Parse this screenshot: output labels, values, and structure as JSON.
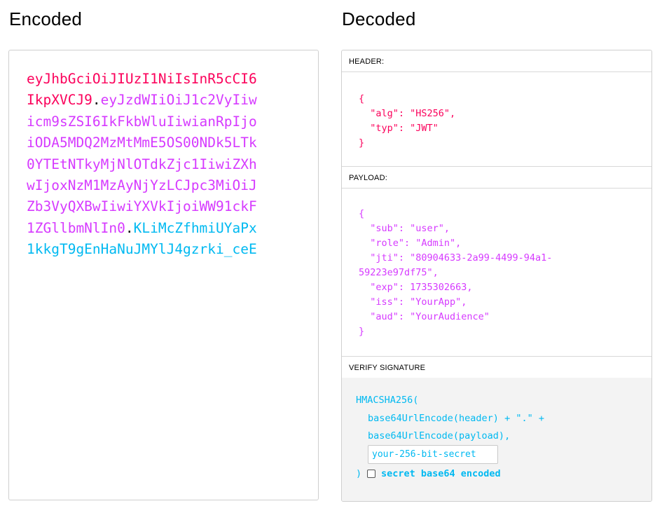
{
  "encoded": {
    "title": "Encoded",
    "header_lines": [
      "eyJhbGciOiJIUzI1NiIsInR5cCI6",
      "IkpXVCJ9"
    ],
    "dot1": ".",
    "payload_first": "eyJzdWIiOiJ1c2VyIiw",
    "payload_lines": [
      "icm9sZSI6IkFkbWluIiwianRpIjo",
      "iODA5MDQ2MzMtMmE5OS00NDk5LTk",
      "0YTEtNTkyMjNlOTdkZjc1IiwiZXh",
      "wIjoxNzM1MzAyNjYzLCJpc3MiOiJ",
      "Zb3VyQXBwIiwiYXVkIjoiWW91ckF"
    ],
    "payload_last": "1ZGllbmNlIn0",
    "dot2": ".",
    "signature_first": "KLiMcZfhmiUYaPx",
    "signature_last": "1kkgT9gEnHaNuJMYlJ4gzrki_ceE"
  },
  "decoded": {
    "title": "Decoded",
    "header_label": "HEADER:",
    "header_json": "{\n  \"alg\": \"HS256\",\n  \"typ\": \"JWT\"\n}",
    "payload_label": "PAYLOAD:",
    "payload_json": "{\n  \"sub\": \"user\",\n  \"role\": \"Admin\",\n  \"jti\": \"80904633-2a99-4499-94a1-\n59223e97df75\",\n  \"exp\": 1735302663,\n  \"iss\": \"YourApp\",\n  \"aud\": \"YourAudience\"\n}",
    "signature_label": "VERIFY SIGNATURE",
    "signature": {
      "func_open": "HMACSHA256(",
      "line1": "base64UrlEncode(header) + \".\" +",
      "line2": "base64UrlEncode(payload),",
      "secret_placeholder": "your-256-bit-secret",
      "func_close": ")",
      "base64_label": "secret base64 encoded",
      "base64_checked": false
    }
  },
  "colors": {
    "header": "#fb015b",
    "payload": "#d63aff",
    "signature": "#00b9f1"
  }
}
